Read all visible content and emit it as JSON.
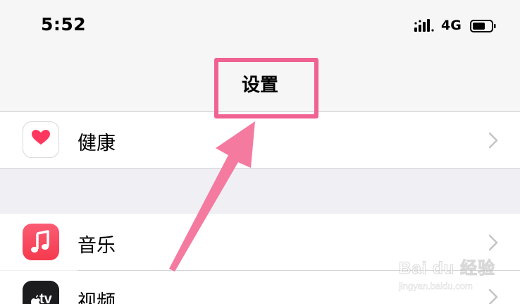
{
  "status_bar": {
    "time": "5:52",
    "network": "4G",
    "signal_icon": "cellular-signal-icon",
    "battery_icon": "battery-icon"
  },
  "nav": {
    "title": "设置"
  },
  "rows": [
    {
      "label": "健康",
      "icon": "health-heart-icon",
      "icon_color": "#ff375f"
    },
    {
      "label": "音乐",
      "icon": "music-note-icon",
      "icon_color": "#fa4b5c"
    },
    {
      "label": "视频",
      "icon": "apple-tv-icon",
      "icon_color": "#1c1c1e"
    }
  ],
  "tv_icon_text": "tv",
  "annotation": {
    "highlight_color": "#f06292",
    "arrow_icon": "pointer-arrow-icon"
  },
  "watermark": {
    "main": "Bai du 经验",
    "sub": "jingyan.baidu.com"
  }
}
